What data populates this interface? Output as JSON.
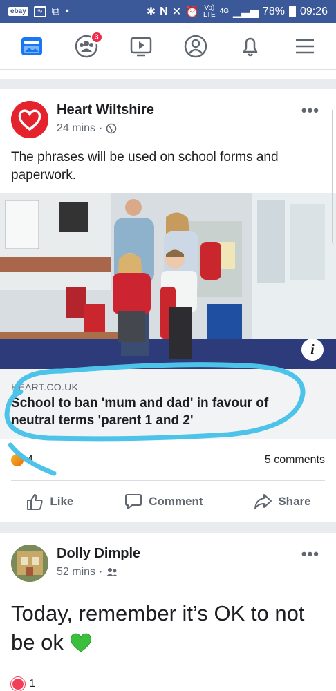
{
  "status_bar": {
    "ebay": "ebay",
    "volte": "Vo)",
    "lte": "LTE",
    "network": "4G",
    "battery": "78%",
    "time": "09:26"
  },
  "nav": {
    "friend_requests_badge": "3"
  },
  "post1": {
    "author": "Heart Wiltshire",
    "time": "24 mins",
    "text": "The phrases will be used on school forms and paperwork.",
    "link_domain": "HEART.CO.UK",
    "link_title": "School to ban 'mum and dad' in favour of neutral terms 'parent 1 and 2'",
    "reactions_count": "4",
    "comments": "5 comments",
    "actions": {
      "like": "Like",
      "comment": "Comment",
      "share": "Share"
    }
  },
  "post2": {
    "author": "Dolly Dimple",
    "time": "52 mins",
    "text": "Today, remember it’s OK to not be ok",
    "reactions_count": "1"
  },
  "colors": {
    "facebook_blue": "#3b5998",
    "annotation": "#4ec3ea",
    "heart_red": "#e5232d"
  }
}
